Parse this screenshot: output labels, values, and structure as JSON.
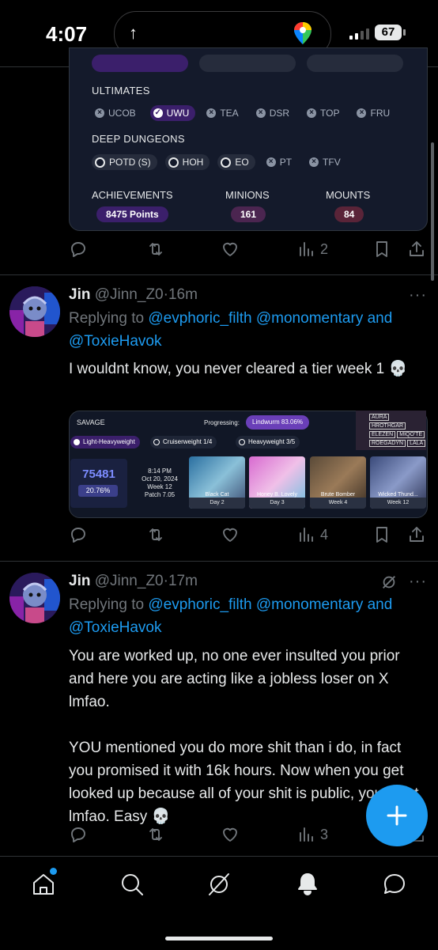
{
  "status_bar": {
    "time": "4:07",
    "battery": "67"
  },
  "card_top": {
    "ultimates_label": "ULTIMATES",
    "ultimates": [
      {
        "label": "UCOB",
        "on": false
      },
      {
        "label": "UWU",
        "on": true
      },
      {
        "label": "TEA",
        "on": false
      },
      {
        "label": "DSR",
        "on": false
      },
      {
        "label": "TOP",
        "on": false
      },
      {
        "label": "FRU",
        "on": false
      }
    ],
    "deep_label": "DEEP DUNGEONS",
    "deep": [
      {
        "label": "POTD (S)",
        "on": true
      },
      {
        "label": "HOH",
        "on": true
      },
      {
        "label": "EO",
        "on": true
      },
      {
        "label": "PT",
        "on": false
      },
      {
        "label": "TFV",
        "on": false
      }
    ],
    "achievements_label": "ACHIEVEMENTS",
    "achievements_value": "8475 Points",
    "minions_label": "MINIONS",
    "minions_value": "161",
    "mounts_label": "MOUNTS",
    "mounts_value": "84"
  },
  "actions_1": {
    "views": "2"
  },
  "tweet_1": {
    "name": "Jin",
    "handle": "@Jinn_Z0",
    "sep": "·",
    "age": "16m",
    "replying_prefix": "Replying to",
    "mention_1": "@evphoric_filth",
    "mention_2": "@monomentary",
    "and": "and",
    "mention_3": "@ToxieHavok",
    "text": "I wouldnt know, you never cleared a tier week 1 💀"
  },
  "card_savage": {
    "title": "SAVAGE",
    "progressing_label": "Progressing:",
    "progressing_value": "Lindwurm 83.06%",
    "tiers": [
      {
        "label": "Light-Heavyweight",
        "count": ""
      },
      {
        "label": "Cruiserweight",
        "count": "1/4"
      },
      {
        "label": "Heavyweight",
        "count": "3/5"
      }
    ],
    "score": "75481",
    "percent": "20.76%",
    "clock": "8:14 PM",
    "date": "Oct 20, 2024",
    "week": "Week 12",
    "patch": "Patch 7.05",
    "bosses": [
      {
        "name": "Black Cat",
        "day": "Day 2"
      },
      {
        "name": "Honey B. Lovely",
        "day": "Day 3"
      },
      {
        "name": "Brute Bomber",
        "day": "Week 4"
      },
      {
        "name": "Wicked Thund...",
        "day": "Week 12"
      }
    ],
    "tags": [
      "AURA",
      "HROTHGAR",
      "ELEZEN",
      "MIQO'TE",
      "ROEGADYN",
      "LALA"
    ]
  },
  "actions_2": {
    "views": "4"
  },
  "tweet_2": {
    "name": "Jin",
    "handle": "@Jinn_Z0",
    "sep": "·",
    "age": "17m",
    "replying_prefix": "Replying to",
    "mention_1": "@evphoric_filth",
    "mention_2": "@monomentary",
    "and": "and",
    "mention_3": "@ToxieHavok",
    "para_1": "You are worked up, no one ever insulted you prior and here you are acting like a jobless loser on X lmfao.",
    "para_2": "YOU mentioned you do more shit than i do, in fact you promised it with 16k hours. Now when you get looked up because all of your shit is public, you pivot lmfao. Easy 💀"
  },
  "actions_3": {
    "views": "3"
  },
  "colors": {
    "accent": "#1d9bf0",
    "text": "#e7e9ea",
    "muted": "#71767b",
    "purple": "#3b1f6b"
  }
}
